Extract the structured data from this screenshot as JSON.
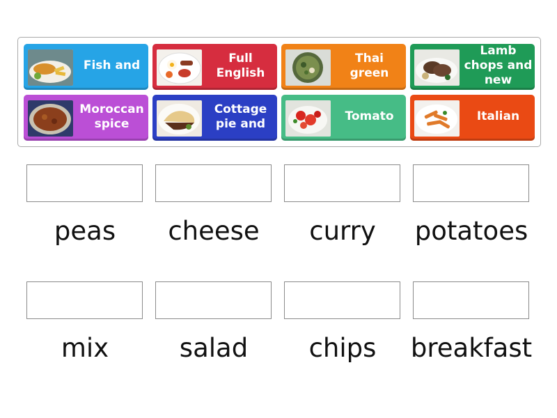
{
  "tiles": [
    {
      "label": "Fish and",
      "icon": "fish-and-chips-photo",
      "color": "#26a4e6"
    },
    {
      "label": "Full English",
      "icon": "full-english-breakfast-photo",
      "color": "#d62d3f"
    },
    {
      "label": "Thai green",
      "icon": "thai-green-curry-photo",
      "color": "#f18217"
    },
    {
      "label": "Lamb chops and new",
      "icon": "lamb-chops-photo",
      "color": "#1f9b57"
    },
    {
      "label": "Moroccan spice",
      "icon": "moroccan-spice-photo",
      "color": "#bb4fd6"
    },
    {
      "label": "Cottage pie and",
      "icon": "cottage-pie-photo",
      "color": "#2b3fc4"
    },
    {
      "label": "Tomato",
      "icon": "tomato-salad-photo",
      "color": "#46bc86"
    },
    {
      "label": "Italian",
      "icon": "italian-pasta-photo",
      "color": "#ea4a14"
    }
  ],
  "targets": [
    {
      "word": "peas"
    },
    {
      "word": "cheese"
    },
    {
      "word": "curry"
    },
    {
      "word": "potatoes"
    },
    {
      "word": "mix"
    },
    {
      "word": "salad"
    },
    {
      "word": "chips"
    },
    {
      "word": "breakfast"
    }
  ]
}
